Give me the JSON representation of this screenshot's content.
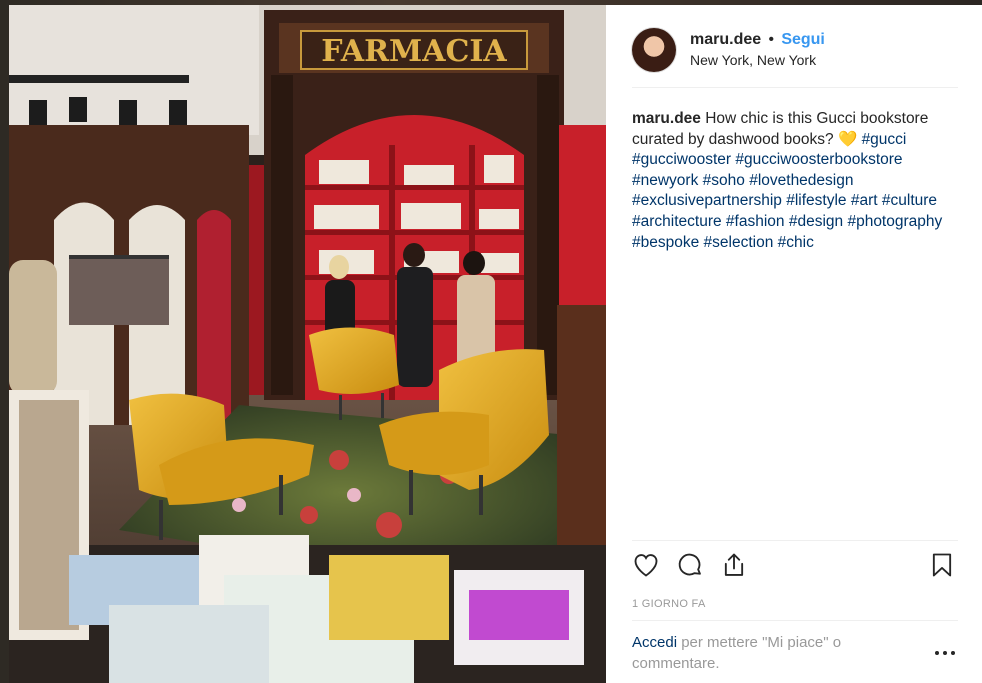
{
  "post": {
    "username": "maru.dee",
    "follow_label": "Segui",
    "location": "New York, New York",
    "caption_text": "How chic is this Gucci bookstore curated by dashwood books? 💛",
    "hashtags": [
      "#gucci",
      "#gucciwooster",
      "#gucciwoosterbookstore",
      "#newyork",
      "#soho",
      "#lovethedesign",
      "#exclusivepartnership",
      "#lifestyle",
      "#art",
      "#culture",
      "#architecture",
      "#fashion",
      "#design",
      "#photography",
      "#bespoke",
      "#selection",
      "#chic"
    ],
    "time_ago": "1 GIORNO FA",
    "login_link": "Accedi",
    "login_text": "per mettere \"Mi piace\" o commentare."
  },
  "photo": {
    "sign_text": "FARMACIA",
    "colors": {
      "shelf_red": "#c8202a",
      "chair_yellow": "#d9a520",
      "wood": "#4a2a1c",
      "gold": "#c89a3c"
    }
  },
  "icons": {
    "like": "heart-icon",
    "comment": "comment-icon",
    "share": "share-icon",
    "save": "bookmark-icon",
    "more": "more-options-icon"
  },
  "colors": {
    "link_blue": "#3897f0",
    "text": "#262626",
    "muted": "#999999",
    "hashtag": "#003569"
  }
}
